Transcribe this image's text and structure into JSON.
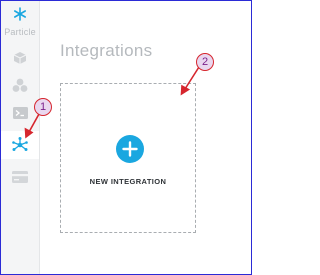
{
  "sidebar": {
    "logo_text": "Particle",
    "items": [
      {
        "icon": "cube-icon"
      },
      {
        "icon": "cluster-icon"
      },
      {
        "icon": "console-icon"
      },
      {
        "icon": "integrations-icon",
        "active": true
      },
      {
        "icon": "billing-card-icon"
      }
    ]
  },
  "main": {
    "title": "Integrations",
    "new_integration_label": "NEW INTEGRATION"
  },
  "annotations": {
    "callout_1": "1",
    "callout_2": "2"
  },
  "colors": {
    "accent": "#1aa7e0",
    "callout_stroke": "#d6262e",
    "callout_fill": "#e9d7ef"
  }
}
